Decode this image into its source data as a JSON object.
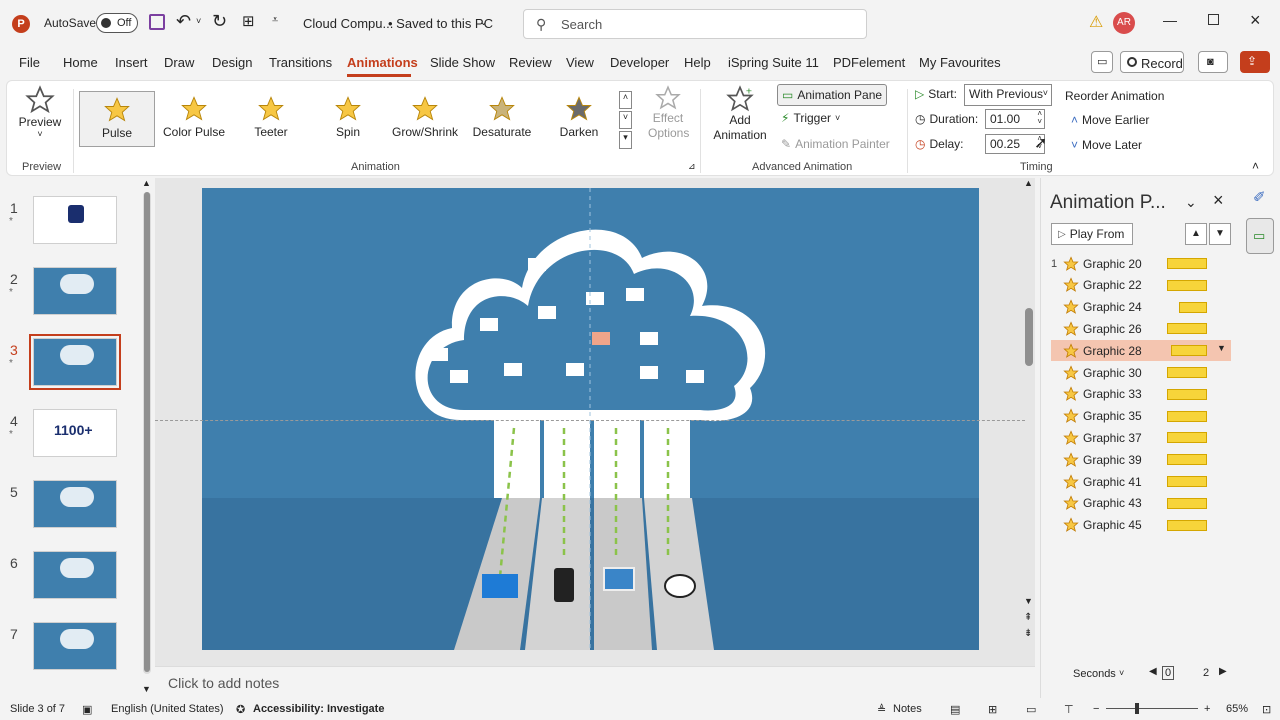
{
  "titlebar": {
    "autosave_label": "AutoSave",
    "autosave_state": "Off",
    "doc_title": "Cloud Compu...",
    "save_status": "• Saved to this PC",
    "search_placeholder": "Search",
    "user_initials": "AR"
  },
  "tabs": [
    "File",
    "Home",
    "Insert",
    "Draw",
    "Design",
    "Transitions",
    "Animations",
    "Slide Show",
    "Review",
    "View",
    "Developer",
    "Help",
    "iSpring Suite 11",
    "PDFelement",
    "My Favourites"
  ],
  "tabs_active": "Animations",
  "record_label": "Record",
  "ribbon": {
    "preview_label": "Preview",
    "preview_group": "Preview",
    "animations": [
      "Pulse",
      "Color Pulse",
      "Teeter",
      "Spin",
      "Grow/Shrink",
      "Desaturate",
      "Darken"
    ],
    "selected_animation": "Pulse",
    "effect_options": "Effect Options",
    "animation_group": "Animation",
    "add_animation": "Add Animation",
    "animation_pane": "Animation Pane",
    "trigger": "Trigger",
    "animation_painter": "Animation Painter",
    "advanced_group": "Advanced Animation",
    "start_label": "Start:",
    "start_value": "With Previous",
    "duration_label": "Duration:",
    "duration_value": "01.00",
    "delay_label": "Delay:",
    "delay_value": "00.25",
    "timing_group": "Timing",
    "reorder_title": "Reorder Animation",
    "move_earlier": "Move Earlier",
    "move_later": "Move Later"
  },
  "slides": [
    {
      "num": "1",
      "star": "*"
    },
    {
      "num": "2",
      "star": "*"
    },
    {
      "num": "3",
      "star": "*"
    },
    {
      "num": "4",
      "star": "*"
    },
    {
      "num": "5",
      "star": ""
    },
    {
      "num": "6",
      "star": ""
    },
    {
      "num": "7",
      "star": ""
    }
  ],
  "thumb4_text": "1100+",
  "selected_slide": 3,
  "notes_placeholder": "Click to add notes",
  "anim_pane": {
    "title": "Animation P...",
    "play_from": "Play From",
    "items": [
      {
        "num": "1",
        "label": "Graphic 20",
        "bar_start": 0.0
      },
      {
        "num": "",
        "label": "Graphic 22",
        "bar_start": 0.0
      },
      {
        "num": "",
        "label": "Graphic 24",
        "bar_start": 0.3
      },
      {
        "num": "",
        "label": "Graphic 26",
        "bar_start": 0.0
      },
      {
        "num": "",
        "label": "Graphic 28",
        "bar_start": 0.1
      },
      {
        "num": "",
        "label": "Graphic 30",
        "bar_start": 0.0
      },
      {
        "num": "",
        "label": "Graphic 33",
        "bar_start": 0.0
      },
      {
        "num": "",
        "label": "Graphic 35",
        "bar_start": 0.0
      },
      {
        "num": "",
        "label": "Graphic 37",
        "bar_start": 0.0
      },
      {
        "num": "",
        "label": "Graphic 39",
        "bar_start": 0.0
      },
      {
        "num": "",
        "label": "Graphic 41",
        "bar_start": 0.0
      },
      {
        "num": "",
        "label": "Graphic 43",
        "bar_start": 0.0
      },
      {
        "num": "",
        "label": "Graphic 45",
        "bar_start": 0.0
      }
    ],
    "selected_index": 4,
    "seconds_label": "Seconds",
    "timeline_start": "0",
    "timeline_end": "2"
  },
  "status": {
    "slide_info": "Slide 3 of 7",
    "language": "English (United States)",
    "accessibility": "Accessibility: Investigate",
    "notes": "Notes",
    "zoom": "65%"
  },
  "colors": {
    "accent": "#c43e1c",
    "slide_bg": "#3f7fad",
    "bar": "#f7d43a",
    "selected_row": "#f4c5b0"
  }
}
